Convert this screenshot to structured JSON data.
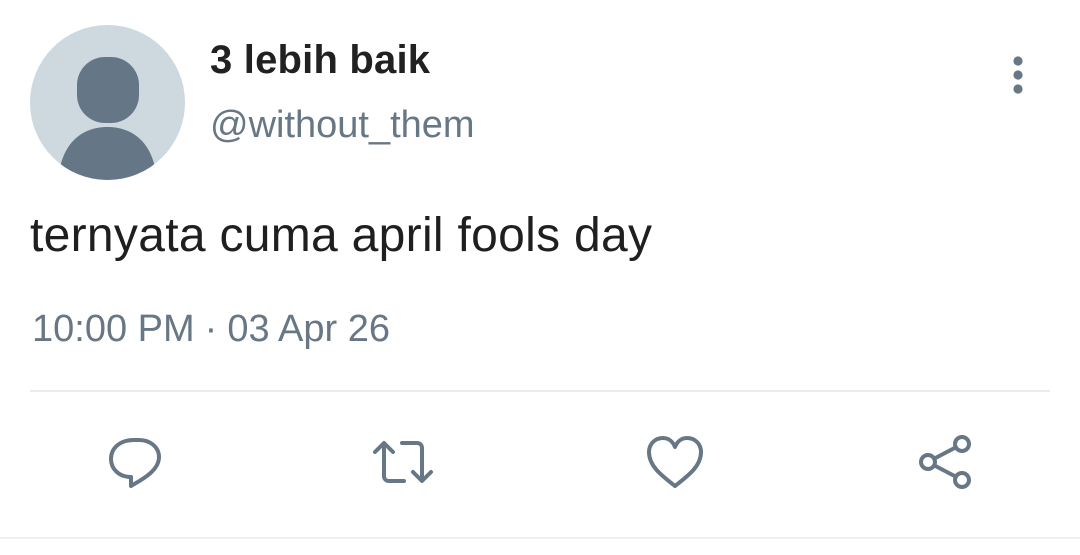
{
  "tweet": {
    "display_name": "3 lebih baik",
    "handle": "@without_them",
    "text": "ternyata cuma april fools day",
    "time": "10:00 PM",
    "separator": "·",
    "date": "03 Apr 26"
  },
  "icons": {
    "avatar": "default-avatar-icon",
    "more": "more-vertical-icon",
    "reply": "reply-icon",
    "retweet": "retweet-icon",
    "like": "heart-icon",
    "share": "share-icon"
  },
  "colors": {
    "avatar_bg": "#ced8df",
    "avatar_figure": "#657786",
    "secondary_text": "#687785",
    "icon_stroke": "#687785",
    "divider": "#e6ecf0"
  }
}
